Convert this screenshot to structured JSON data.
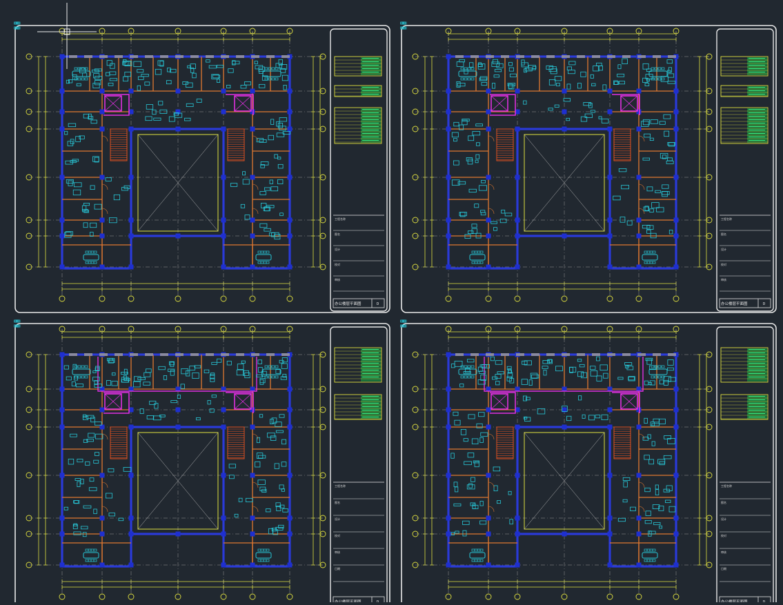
{
  "canvas": {
    "background": "#212830",
    "cursor": "crosshair"
  },
  "colors": {
    "frame": "#e8e8e8",
    "grid": "#e0e040",
    "axis_line": "#9a9a9a",
    "wall": "#2a3ad8",
    "column": "#1e2fd0",
    "partition": "#e07830",
    "furniture": "#28c8d8",
    "duct": "#e030e0",
    "stair": "#e05020",
    "table_fill": "#1a6e3a",
    "table_text": "#40f080"
  },
  "sheets": [
    {
      "name": "sheet-1",
      "title_block": {
        "fields": [
          "工程名称",
          "图名",
          "设计",
          "校对",
          "审核"
        ],
        "drawing_title": "办公楼层平面图",
        "sheet_no": "D"
      }
    },
    {
      "name": "sheet-2",
      "title_block": {
        "fields": [
          "工程名称",
          "图名",
          "设计",
          "校对",
          "审核"
        ],
        "drawing_title": "办公楼层平面图",
        "sheet_no": "D"
      }
    },
    {
      "name": "sheet-3",
      "title_block": {
        "fields": [
          "工程名称",
          "图名",
          "设计",
          "校对",
          "审核",
          "日期"
        ],
        "drawing_title": "办公楼层平面图",
        "sheet_no": "D"
      }
    },
    {
      "name": "sheet-4",
      "title_block": {
        "fields": [
          "工程名称",
          "图名",
          "设计",
          "校对",
          "审核",
          "日期"
        ],
        "drawing_title": "办公楼层平面图",
        "sheet_no": "D"
      }
    }
  ]
}
